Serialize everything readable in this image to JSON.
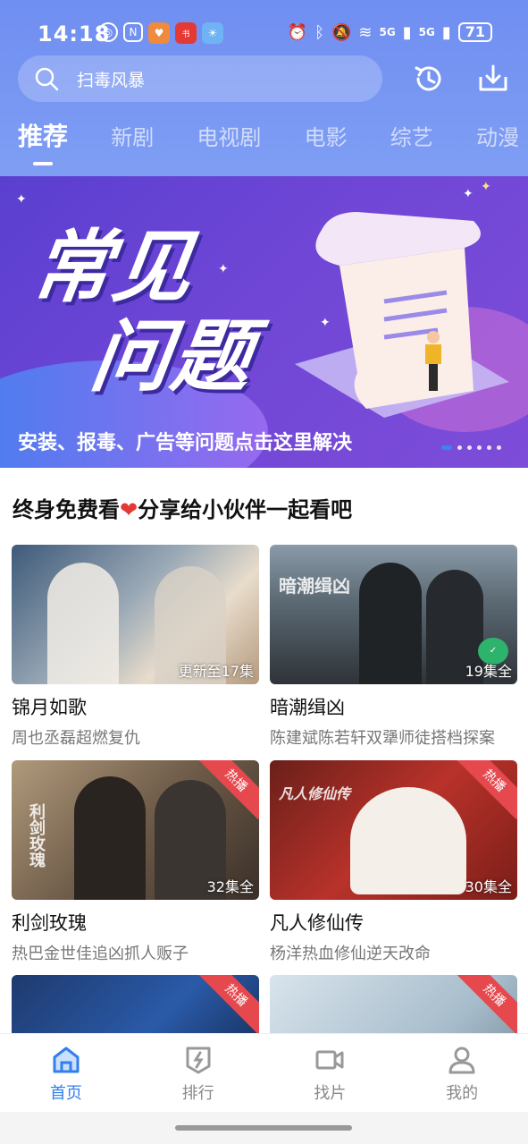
{
  "status_bar": {
    "time": "14:18",
    "battery": "71",
    "signal_labels": [
      "5G",
      "5G"
    ],
    "icons": [
      "nfc-icon",
      "alarm-icon",
      "bluetooth-icon",
      "mute-icon",
      "wifi-icon",
      "signal-icon"
    ]
  },
  "search": {
    "placeholder": "扫毒风暴"
  },
  "tabs": [
    "推荐",
    "新剧",
    "电视剧",
    "电影",
    "综艺",
    "动漫"
  ],
  "banner": {
    "title_line1": "常见",
    "title_line2": "问题",
    "caption": "安装、报毒、广告等问题点击这里解决"
  },
  "share_text_before": "终身免费看",
  "share_text_after": "分享给小伙伴一起看吧",
  "cards": [
    {
      "title": "锦月如歌",
      "desc": "周也丞磊超燃复仇",
      "eps": "更新至17集",
      "hot": ""
    },
    {
      "title": "暗潮缉凶",
      "desc": "陈建斌陈若轩双犟师徒搭档探案",
      "eps": "19集全",
      "hot": ""
    },
    {
      "title": "利剑玫瑰",
      "desc": "热巴金世佳追凶抓人贩子",
      "eps": "32集全",
      "hot": "热播"
    },
    {
      "title": "凡人修仙传",
      "desc": "杨洋热血修仙逆天改命",
      "eps": "30集全",
      "hot": "热播"
    },
    {
      "title": "",
      "desc": "",
      "eps": "",
      "hot": "热播"
    },
    {
      "title": "",
      "desc": "",
      "eps": "",
      "hot": "热播"
    }
  ],
  "thumb_texts": {
    "card2": "暗潮缉凶",
    "card3": "利剑玫瑰",
    "card4": "凡人修仙传"
  },
  "nav": [
    {
      "label": "首页",
      "icon": "home-icon",
      "active": true
    },
    {
      "label": "排行",
      "icon": "ranking-icon",
      "active": false
    },
    {
      "label": "找片",
      "icon": "video-icon",
      "active": false
    },
    {
      "label": "我的",
      "icon": "user-icon",
      "active": false
    }
  ],
  "colors": {
    "accent": "#2f80ed",
    "header": "#7593f2",
    "hot": "#e5484d"
  }
}
